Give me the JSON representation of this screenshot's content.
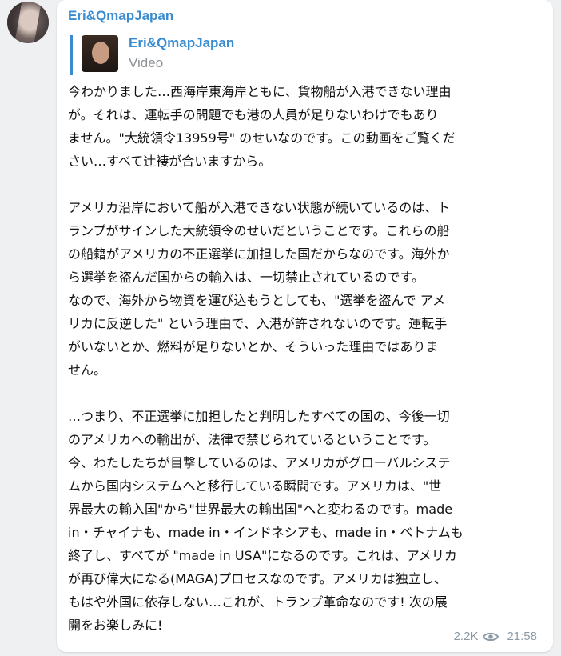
{
  "message": {
    "author": "Eri&QmapJapan",
    "forward": {
      "name": "Eri&QmapJapan",
      "type": "Video"
    },
    "lines": [
      "今わかりました…西海岸東海岸ともに、貨物船が入港できない理由",
      "が。それは、運転手の問題でも港の人員が足りないわけでもあり",
      "ません。\"大統領令13959号\" のせいなのです。この動画をご覧くだ",
      "さい…すべて辻褄が合いますから。",
      "",
      "アメリカ沿岸において船が入港できない状態が続いているのは、ト",
      "ランプがサインした大統領令のせいだということです。これらの船",
      "の船籍がアメリカの不正選挙に加担した国だからなのです。海外か",
      "ら選挙を盗んだ国からの輸入は、一切禁止されているのです。",
      "なので、海外から物資を運び込もうとしても、\"選挙を盗んで アメ",
      "リカに反逆した\" という理由で、入港が許されないのです。運転手",
      "がいないとか、燃料が足りないとか、そういった理由ではありま",
      "せん。",
      "",
      "…つまり、不正選挙に加担したと判明したすべての国の、今後一切",
      "のアメリカへの輸出が、法律で禁じられているということです。",
      "今、わたしたちが目撃しているのは、アメリカがグローバルシステ",
      "ムから国内システムへと移行している瞬間です。アメリカは、\"世",
      "界最大の輸入国\"から\"世界最大の輸出国\"へと変わるのです。made",
      "in・チャイナも、made in・インドネシアも、made in・ベトナムも",
      "終了し、すべてが \"made in USA\"になるのです。これは、アメリカ",
      "が再び偉大になる(MAGA)プロセスなのです。アメリカは独立し、",
      "もはや外国に依存しない…これが、トランプ革命なのです! 次の展",
      "開をお楽しみに!"
    ],
    "views": "2.2K",
    "time": "21:58"
  },
  "icons": {
    "views": "eye-icon",
    "avatar": "avatar-image"
  },
  "colors": {
    "accent": "#3a8cd0",
    "meta": "#8c9aa6",
    "background": "#eef0f2",
    "bubble": "#ffffff"
  }
}
